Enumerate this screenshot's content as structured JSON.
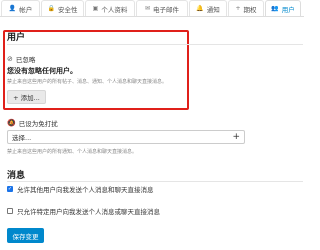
{
  "tabs": [
    {
      "icon": "user-icon",
      "glyph": "👤",
      "label": "帐户"
    },
    {
      "icon": "lock-icon",
      "glyph": "🔒",
      "label": "安全性"
    },
    {
      "icon": "id-card-icon",
      "glyph": "▣",
      "label": "个人资料"
    },
    {
      "icon": "envelope-icon",
      "glyph": "✉",
      "label": "电子邮件"
    },
    {
      "icon": "bell-icon",
      "glyph": "🔔",
      "label": "通知"
    },
    {
      "icon": "plus-icon",
      "glyph": "+",
      "label": "期权"
    },
    {
      "icon": "users-icon",
      "glyph": "👥",
      "label": "用户",
      "active": true
    }
  ],
  "users_section": {
    "title": "用户",
    "muted_label": "已忽略",
    "empty_message": "您没有忽略任何用户。",
    "muted_help": "禁止来自这些用户的所有帖子、消息、通知、个人消息和聊天直接消息。",
    "add_button": "+ 添加..."
  },
  "dnd_section": {
    "label": "已设为免打扰",
    "select_placeholder": "选择...",
    "help": "禁止来自这些用户的所有通知、个人消息和聊天直接消息。"
  },
  "messages_section": {
    "title": "消息",
    "options": [
      {
        "label": "允许其他用户向我发送个人消息和聊天直接消息",
        "checked": true
      },
      {
        "label": "只允许特定用户向我发送个人消息或聊天直接消息",
        "checked": false
      }
    ]
  },
  "save_button": "保存变更",
  "colors": {
    "accent": "#0088cc",
    "highlight_border": "#e0201a",
    "checkbox_checked": "#1a73e8"
  }
}
